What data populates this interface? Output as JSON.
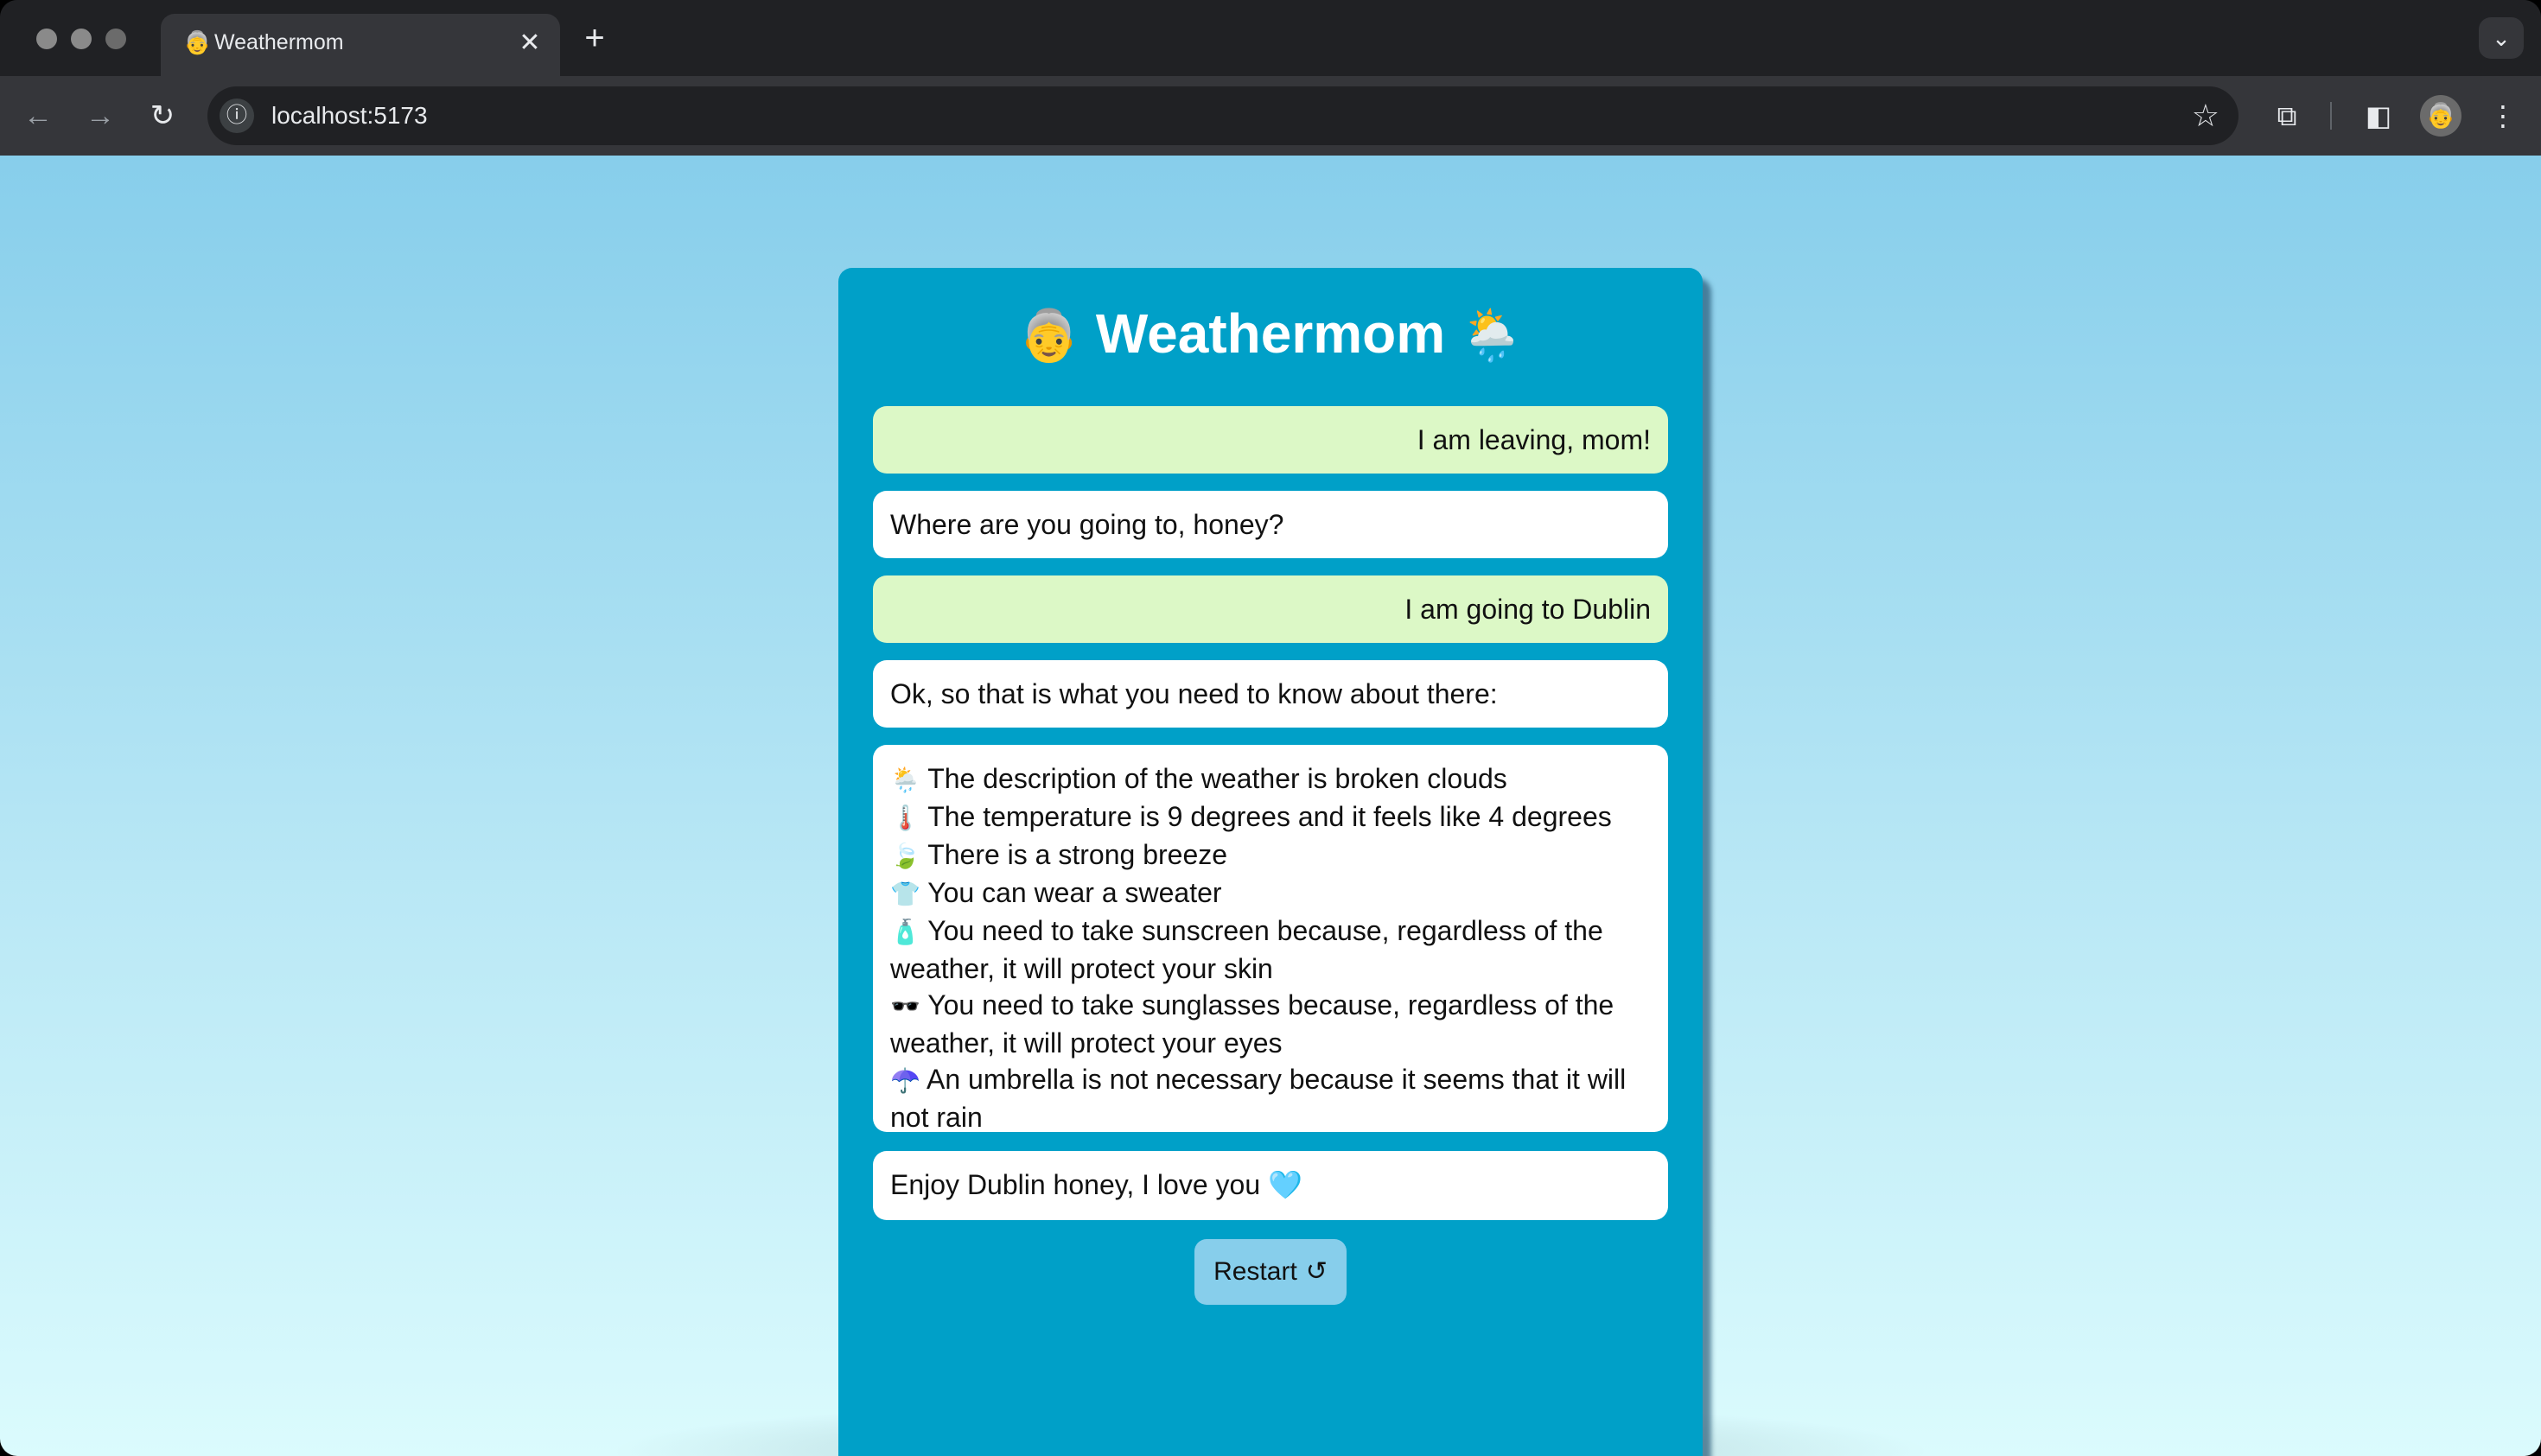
{
  "browser": {
    "tab": {
      "favicon": "👵",
      "title": "Weathermom",
      "close_glyph": "✕"
    },
    "new_tab_glyph": "+",
    "tab_search_glyph": "⌄",
    "toolbar": {
      "back_glyph": "←",
      "forward_glyph": "→",
      "reload_glyph": "↻",
      "info_glyph": "ⓘ",
      "url": "localhost:5173",
      "bookmark_glyph": "☆",
      "extensions_glyph": "⧉",
      "side_panel_glyph": "◧",
      "avatar_glyph": "👵",
      "menu_glyph": "⋮"
    }
  },
  "app": {
    "title_left_emoji": "👵",
    "title": "Weathermom",
    "title_right_emoji": "🌦️",
    "background_top": "#87ceeb",
    "background_bottom": "#dbfbfd",
    "card_color": "#00a0c8",
    "user_bubble_color": "#dcf8c6",
    "mom_bubble_color": "#ffffff"
  },
  "messages": {
    "m1": "I am leaving, mom!",
    "m2": "Where are you going to, honey?",
    "m3": "I am going to Dublin",
    "m4": "Ok, so that is what you need to know about there:",
    "weather": [
      {
        "emoji": "🌦️",
        "text": "The description of the weather is broken clouds"
      },
      {
        "emoji": "🌡️",
        "text": "The temperature is 9 degrees and it feels like 4 degrees"
      },
      {
        "emoji": "🍃",
        "text": "There is a strong breeze"
      },
      {
        "emoji": "👕",
        "text": "You can wear a sweater"
      },
      {
        "emoji": "🧴",
        "text": "You need to take sunscreen because, regardless of the weather, it will protect your skin"
      },
      {
        "emoji": "🕶️",
        "text": "You need to take sunglasses because, regardless of the weather, it will protect your eyes"
      },
      {
        "emoji": "☂️",
        "text": "An umbrella is not necessary because it seems that it will not rain"
      }
    ],
    "m6_text": "Enjoy Dublin honey, I love you",
    "m6_emoji": "🩵"
  },
  "restart": {
    "label": "Restart",
    "icon": "↺"
  }
}
